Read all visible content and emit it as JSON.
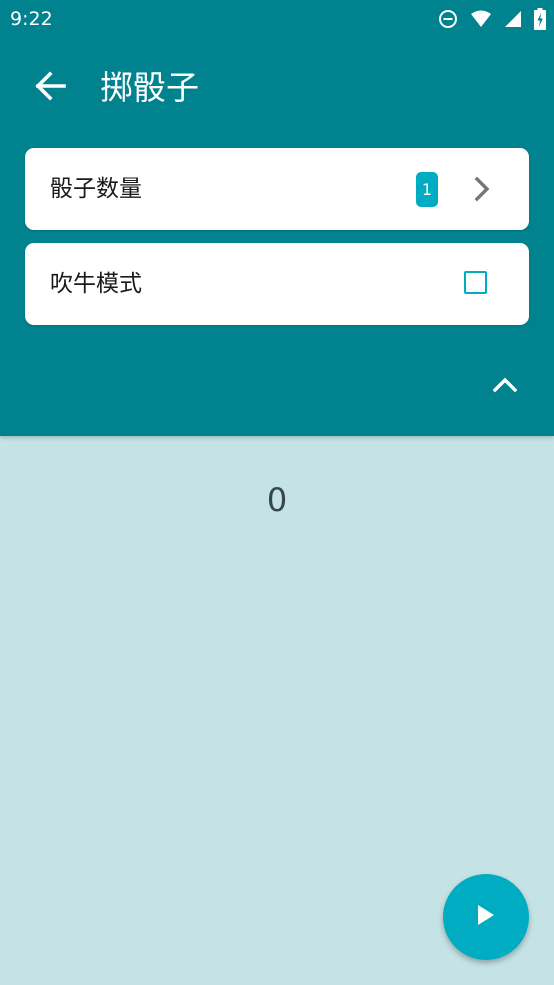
{
  "status_bar": {
    "time": "9:22",
    "icons": [
      "do-not-disturb-icon",
      "wifi-icon",
      "signal-icon",
      "battery-charging-icon"
    ]
  },
  "toolbar": {
    "title": "掷骰子",
    "back_icon": "arrow-back-icon"
  },
  "settings": {
    "dice_count": {
      "label": "骰子数量",
      "value": "1",
      "icon": "chevron-right-icon"
    },
    "bluff_mode": {
      "label": "吹牛模式",
      "checked": false
    }
  },
  "collapse_icon": "chevron-up-icon",
  "result": {
    "value": "0"
  },
  "fab": {
    "icon": "play-icon"
  },
  "colors": {
    "toolbar": "#00838f",
    "background": "#c5e3e5",
    "accent": "#00acc1",
    "card": "#ffffff"
  }
}
